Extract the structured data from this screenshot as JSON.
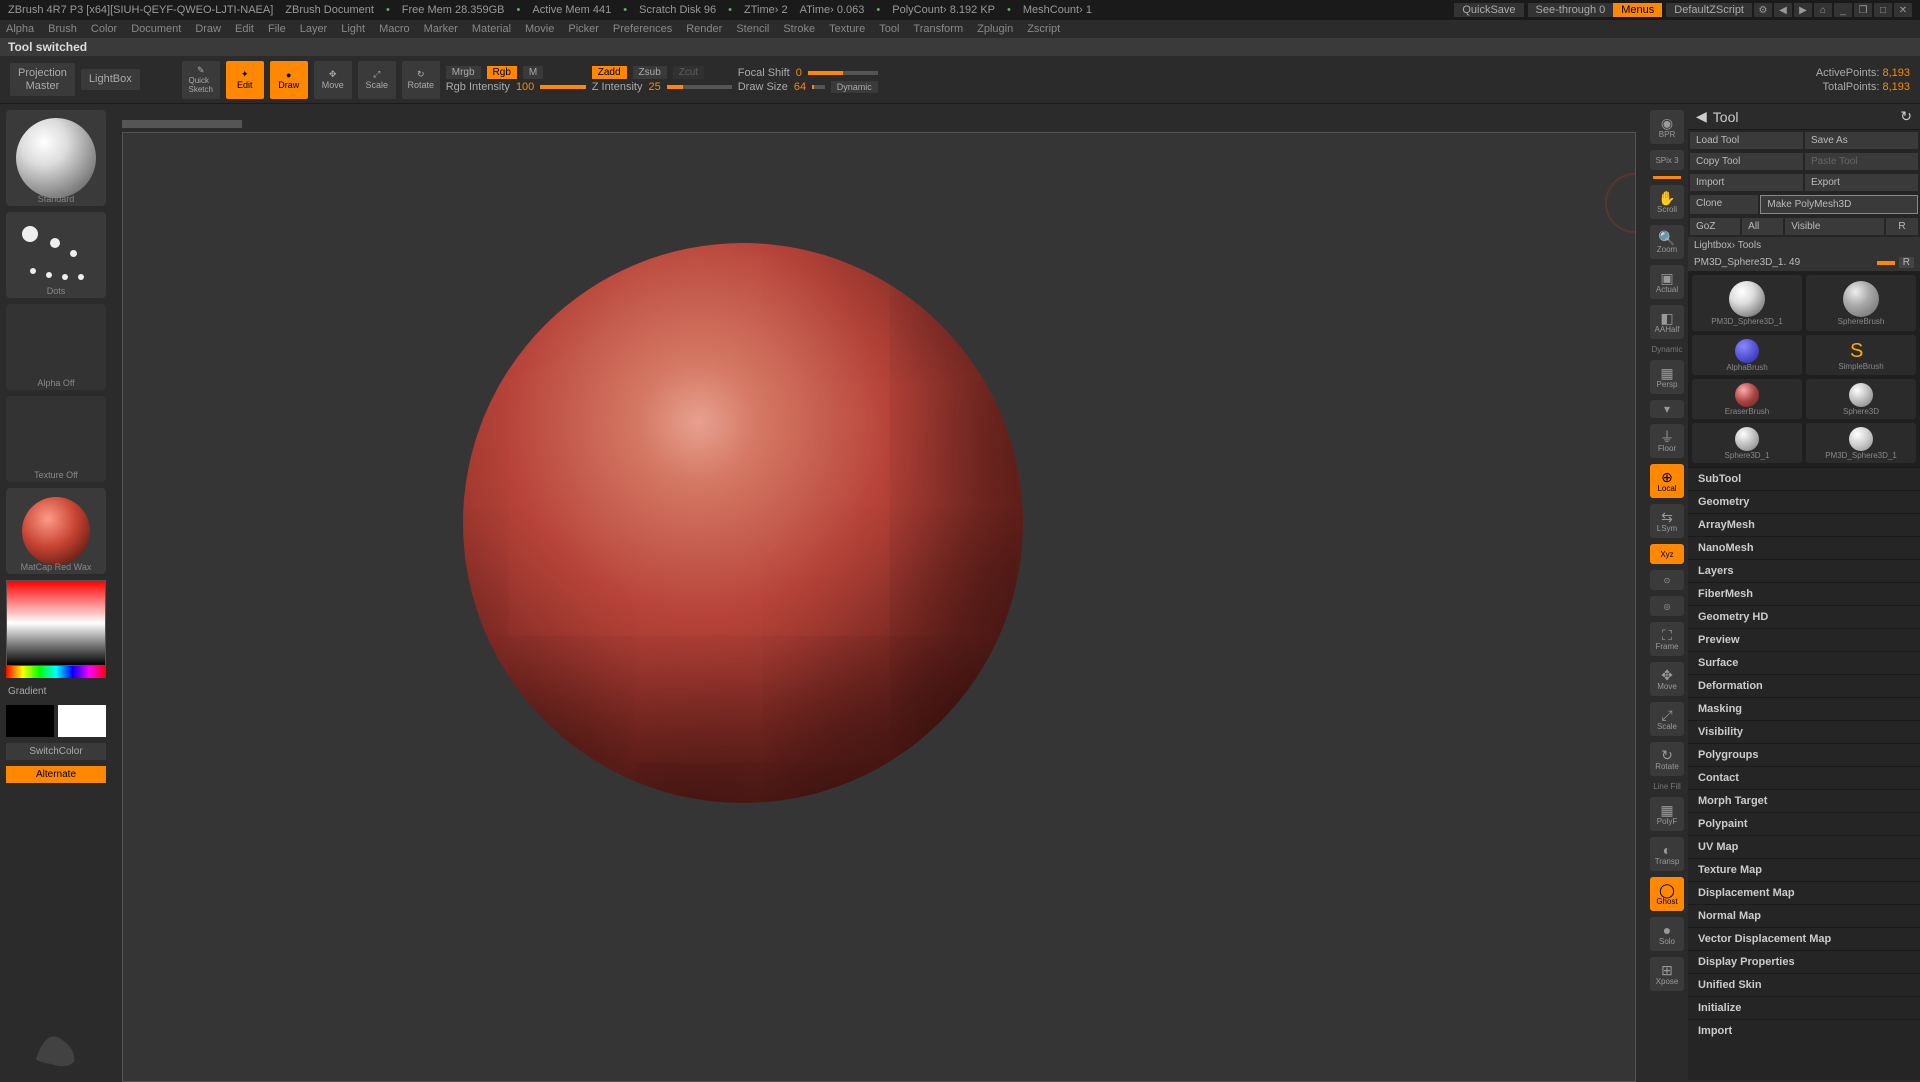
{
  "title": {
    "app": "ZBrush 4R7 P3 [x64][SIUH-QEYF-QWEO-LJTI-NAEA]",
    "doc": "ZBrush Document",
    "mem": "Free Mem 28.359GB",
    "amem": "Active Mem 441",
    "scratch": "Scratch Disk 96",
    "ztime": "ZTime› 2",
    "atime": "ATime› 0.063",
    "poly": "PolyCount› 8.192 KP",
    "mesh": "MeshCount› 1",
    "quicksave": "QuickSave",
    "seethrough": "See-through  0",
    "menus": "Menus",
    "script": "DefaultZScript"
  },
  "menu": [
    "Alpha",
    "Brush",
    "Color",
    "Document",
    "Draw",
    "Edit",
    "File",
    "Layer",
    "Light",
    "Macro",
    "Marker",
    "Material",
    "Movie",
    "Picker",
    "Preferences",
    "Render",
    "Stencil",
    "Stroke",
    "Texture",
    "Tool",
    "Transform",
    "Zplugin",
    "Zscript"
  ],
  "status": "Tool switched",
  "shelf": {
    "projection": "Projection\nMaster",
    "lightbox": "LightBox",
    "quicksketch": "Quick\nSketch",
    "edit": "Edit",
    "draw": "Draw",
    "move": "Move",
    "scale": "Scale",
    "rotate": "Rotate",
    "mrgb": "Mrgb",
    "rgb": "Rgb",
    "m": "M",
    "rgb_intensity_label": "Rgb Intensity",
    "rgb_intensity_val": "100",
    "zadd": "Zadd",
    "zsub": "Zsub",
    "zcut": "Zcut",
    "z_intensity_label": "Z Intensity",
    "z_intensity_val": "25",
    "focal_label": "Focal Shift",
    "focal_val": "0",
    "draw_size_label": "Draw Size",
    "draw_size_val": "64",
    "dynamic": "Dynamic",
    "active_pts_label": "ActivePoints:",
    "active_pts_val": "8,193",
    "total_pts_label": "TotalPoints:",
    "total_pts_val": "8,193"
  },
  "left": {
    "brush_name": "Standard",
    "stroke_name": "Dots",
    "alpha_name": "Alpha Off",
    "texture_name": "Texture Off",
    "material_name": "MatCap Red Wax",
    "gradient": "Gradient",
    "switchcolor": "SwitchColor",
    "alternate": "Alternate"
  },
  "nav": {
    "bpr": "BPR",
    "spix": "SPix 3",
    "scroll": "Scroll",
    "zoom": "Zoom",
    "actual": "Actual",
    "aahalf": "AAHalf",
    "persp": "Persp",
    "floor": "Floor",
    "local": "Local",
    "lsym": "LSym",
    "xyz": "Xyz",
    "frame": "Frame",
    "move": "Move",
    "scale": "Scale",
    "rotate": "Rotate",
    "linefill": "Line Fill",
    "polyf": "PolyF",
    "transp": "Transp",
    "ghost": "Ghost",
    "solo": "Solo",
    "xpose": "Xpose",
    "dynamic": "Dynamic"
  },
  "tool": {
    "header": "Tool",
    "load": "Load Tool",
    "save": "Save As",
    "copy": "Copy Tool",
    "paste": "Paste Tool",
    "import": "Import",
    "export": "Export",
    "clone": "Clone",
    "makepm3d": "Make PolyMesh3D",
    "goz": "GoZ",
    "all": "All",
    "visible": "Visible",
    "r": "R",
    "lightbox": "Lightbox› Tools",
    "current": "PM3D_Sphere3D_1. 49",
    "thumbs": [
      "PM3D_Sphere3D_1",
      "SphereBrush",
      "AlphaBrush",
      "SimpleBrush",
      "EraserBrush",
      "Sphere3D",
      "Sphere3D_1",
      "PM3D_Sphere3D_1"
    ],
    "sections": [
      "SubTool",
      "Geometry",
      "ArrayMesh",
      "NanoMesh",
      "Layers",
      "FiberMesh",
      "Geometry HD",
      "Preview",
      "Surface",
      "Deformation",
      "Masking",
      "Visibility",
      "Polygroups",
      "Contact",
      "Morph Target",
      "Polypaint",
      "UV Map",
      "Texture Map",
      "Displacement Map",
      "Normal Map",
      "Vector Displacement Map",
      "Display Properties",
      "Unified Skin",
      "Initialize",
      "Import"
    ]
  }
}
